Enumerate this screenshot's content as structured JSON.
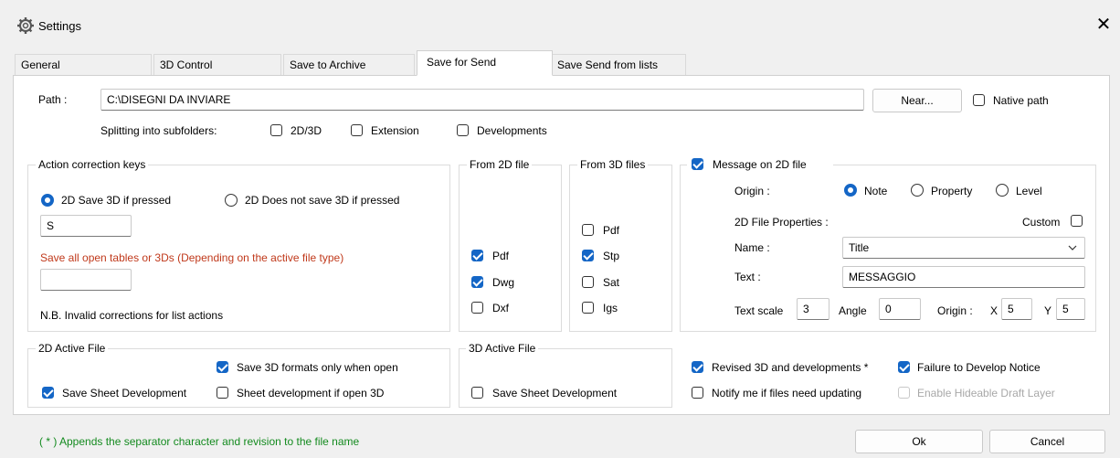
{
  "window": {
    "title": "Settings",
    "close_glyph": "✕"
  },
  "tabs": [
    "General",
    "3D Control",
    "Save to Archive",
    "Save for Send",
    "Save Send from lists"
  ],
  "path": {
    "label": "Path :",
    "value": "C:\\DISEGNI DA INVIARE",
    "near_button": "Near...",
    "native_path_label": "Native path",
    "native_path_checked": false
  },
  "splitting": {
    "label": "Splitting into subfolders:",
    "opt_2d3d": "2D/3D",
    "opt_extension": "Extension",
    "opt_developments": "Developments"
  },
  "action_keys": {
    "title": "Action correction keys",
    "radio_save": "2D Save 3D if pressed",
    "radio_nosave": "2D Does not save 3D if pressed",
    "key_value": "S",
    "save_all_label": "Save all open tables or 3Ds (Depending on the active file type)",
    "save_all_value": "",
    "note": "N.B. Invalid corrections for list actions"
  },
  "from_2d": {
    "title": "From 2D file",
    "items": [
      "Pdf",
      "Dwg",
      "Dxf"
    ],
    "checked": [
      true,
      true,
      false
    ]
  },
  "from_3d": {
    "title": "From 3D files",
    "items": [
      "Pdf",
      "Stp",
      "Sat",
      "Igs"
    ],
    "checked": [
      false,
      true,
      false,
      false
    ]
  },
  "message": {
    "title": "Message on 2D file",
    "origin_label": "Origin :",
    "origin_options": [
      "Note",
      "Property",
      "Level"
    ],
    "origin_selected": "Note",
    "props_label": "2D File Properties :",
    "custom_label": "Custom",
    "name_label": "Name :",
    "name_value": "Title",
    "text_label": "Text :",
    "text_value": "MESSAGGIO",
    "text_scale_label": "Text scale",
    "text_scale_value": "3",
    "angle_label": "Angle",
    "angle_value": "0",
    "origin2_label": "Origin :",
    "x_label": "X",
    "x_value": "5",
    "y_label": "Y",
    "y_value": "5"
  },
  "active_2d": {
    "title": "2D Active File",
    "save_3d_formats": "Save 3D formats only when open",
    "save_sheet": "Save Sheet Development",
    "sheet_if_open": "Sheet development if open 3D"
  },
  "active_3d": {
    "title": "3D Active File",
    "save_sheet": "Save Sheet Development"
  },
  "options": {
    "revised": "Revised 3D and developments *",
    "failure": "Failure to Develop Notice",
    "notify": "Notify me if files need updating",
    "hideable": "Enable Hideable Draft Layer"
  },
  "footer": {
    "note": "( * ) Appends the separator character and revision to the file name",
    "ok": "Ok",
    "cancel": "Cancel"
  },
  "colors": {
    "accent": "#1466c6",
    "warning_text": "#c0391b",
    "footer_note": "#138a1e"
  }
}
